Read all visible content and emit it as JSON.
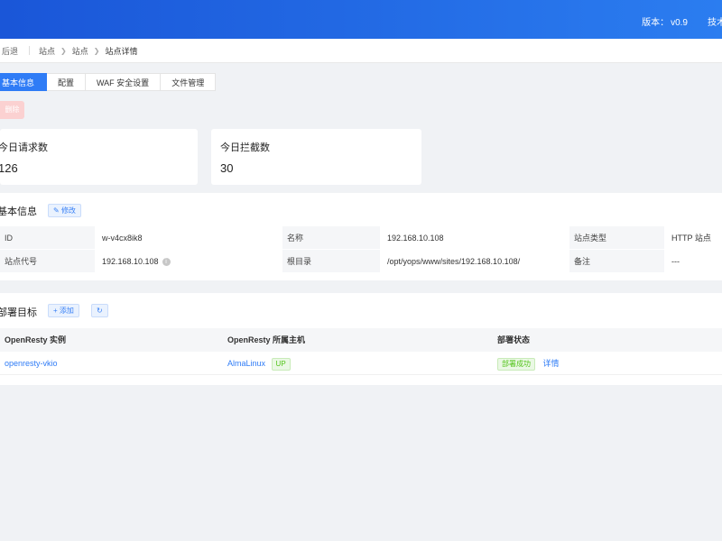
{
  "header": {
    "version_label": "版本：",
    "version_value": "v0.9",
    "tech_label": "技术"
  },
  "breadcrumb": {
    "back": "后退",
    "items": [
      "站点",
      "站点",
      "站点详情"
    ]
  },
  "tabs": [
    "基本信息",
    "配置",
    "WAF 安全设置",
    "文件管理"
  ],
  "actions": {
    "delete_label": "删除"
  },
  "stats": {
    "requests_label": "今日请求数",
    "requests_value": "126",
    "blocked_label": "今日拦截数",
    "blocked_value": "30"
  },
  "basic_info": {
    "title": "基本信息",
    "edit_label": "修改",
    "rows": [
      [
        {
          "k": "ID",
          "v": "w-v4cx8ik8"
        },
        {
          "k": "名称",
          "v": "192.168.10.108"
        },
        {
          "k": "站点类型",
          "v": "HTTP 站点"
        }
      ],
      [
        {
          "k": "站点代号",
          "v": "192.168.10.108"
        },
        {
          "k": "根目录",
          "v": "/opt/yops/www/sites/192.168.10.108/"
        },
        {
          "k": "备注",
          "v": "---"
        }
      ]
    ]
  },
  "deploy": {
    "title": "部署目标",
    "add_label": "+ 添加",
    "refresh_icon": "refresh-icon",
    "columns": [
      "OpenResty 实例",
      "OpenResty 所属主机",
      "部署状态"
    ],
    "rows": [
      {
        "instance": "openresty-vkio",
        "host": "AlmaLinux",
        "host_status": "UP",
        "deploy_status": "部署成功",
        "detail_label": "详情"
      }
    ]
  },
  "colors": {
    "header_start": "#1a56d8",
    "header_end": "#2b7df0",
    "primary": "#2f7cf6",
    "success": "#52c41a",
    "danger_light": "#fbd1d1"
  }
}
